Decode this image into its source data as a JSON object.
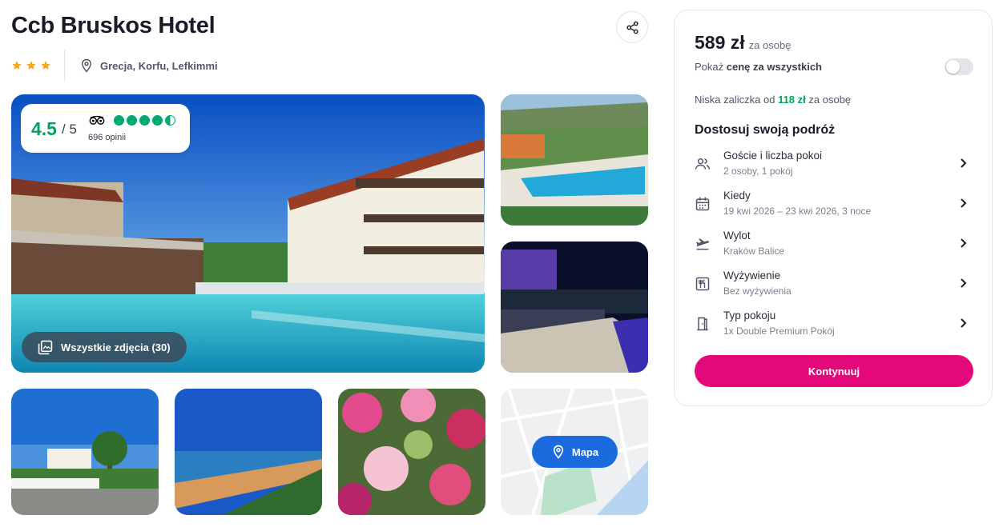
{
  "hotel": {
    "name": "Ccb Bruskos Hotel",
    "stars": 3,
    "location": "Grecja, Korfu, Lefkimmi"
  },
  "rating": {
    "score": "4.5",
    "max": "/ 5",
    "reviews": "696 opinii",
    "tripadvisor_bubbles": 4.5
  },
  "gallery": {
    "all_photos_label": "Wszystkie zdjęcia (30)",
    "map_label": "Mapa"
  },
  "booking": {
    "price": "589 zł",
    "price_unit": "za osobę",
    "toggle_prefix": "Pokaż",
    "toggle_bold": "cenę za wszystkich",
    "toggle_on": false,
    "deposit_prefix": "Niska zaliczka od",
    "deposit_amount": "118 zł",
    "deposit_suffix": "za osobę",
    "customize_title": "Dostosuj swoją podróż",
    "options": [
      {
        "title": "Goście i liczba pokoi",
        "value": "2 osoby, 1 pokój",
        "icon": "guests-icon"
      },
      {
        "title": "Kiedy",
        "value": "19 kwi 2026 – 23 kwi 2026, 3 noce",
        "icon": "calendar-icon"
      },
      {
        "title": "Wylot",
        "value": "Kraków Balice",
        "icon": "plane-departure-icon"
      },
      {
        "title": "Wyżywienie",
        "value": "Bez wyżywienia",
        "icon": "cutlery-icon"
      },
      {
        "title": "Typ pokoju",
        "value": "1x Double Premium Pokój",
        "icon": "door-icon"
      }
    ],
    "continue_label": "Kontynuuj"
  },
  "colors": {
    "accent": "#e4097a",
    "rating_green": "#00a35a",
    "star_orange": "#f5a623",
    "map_button": "#1b6bdf"
  }
}
